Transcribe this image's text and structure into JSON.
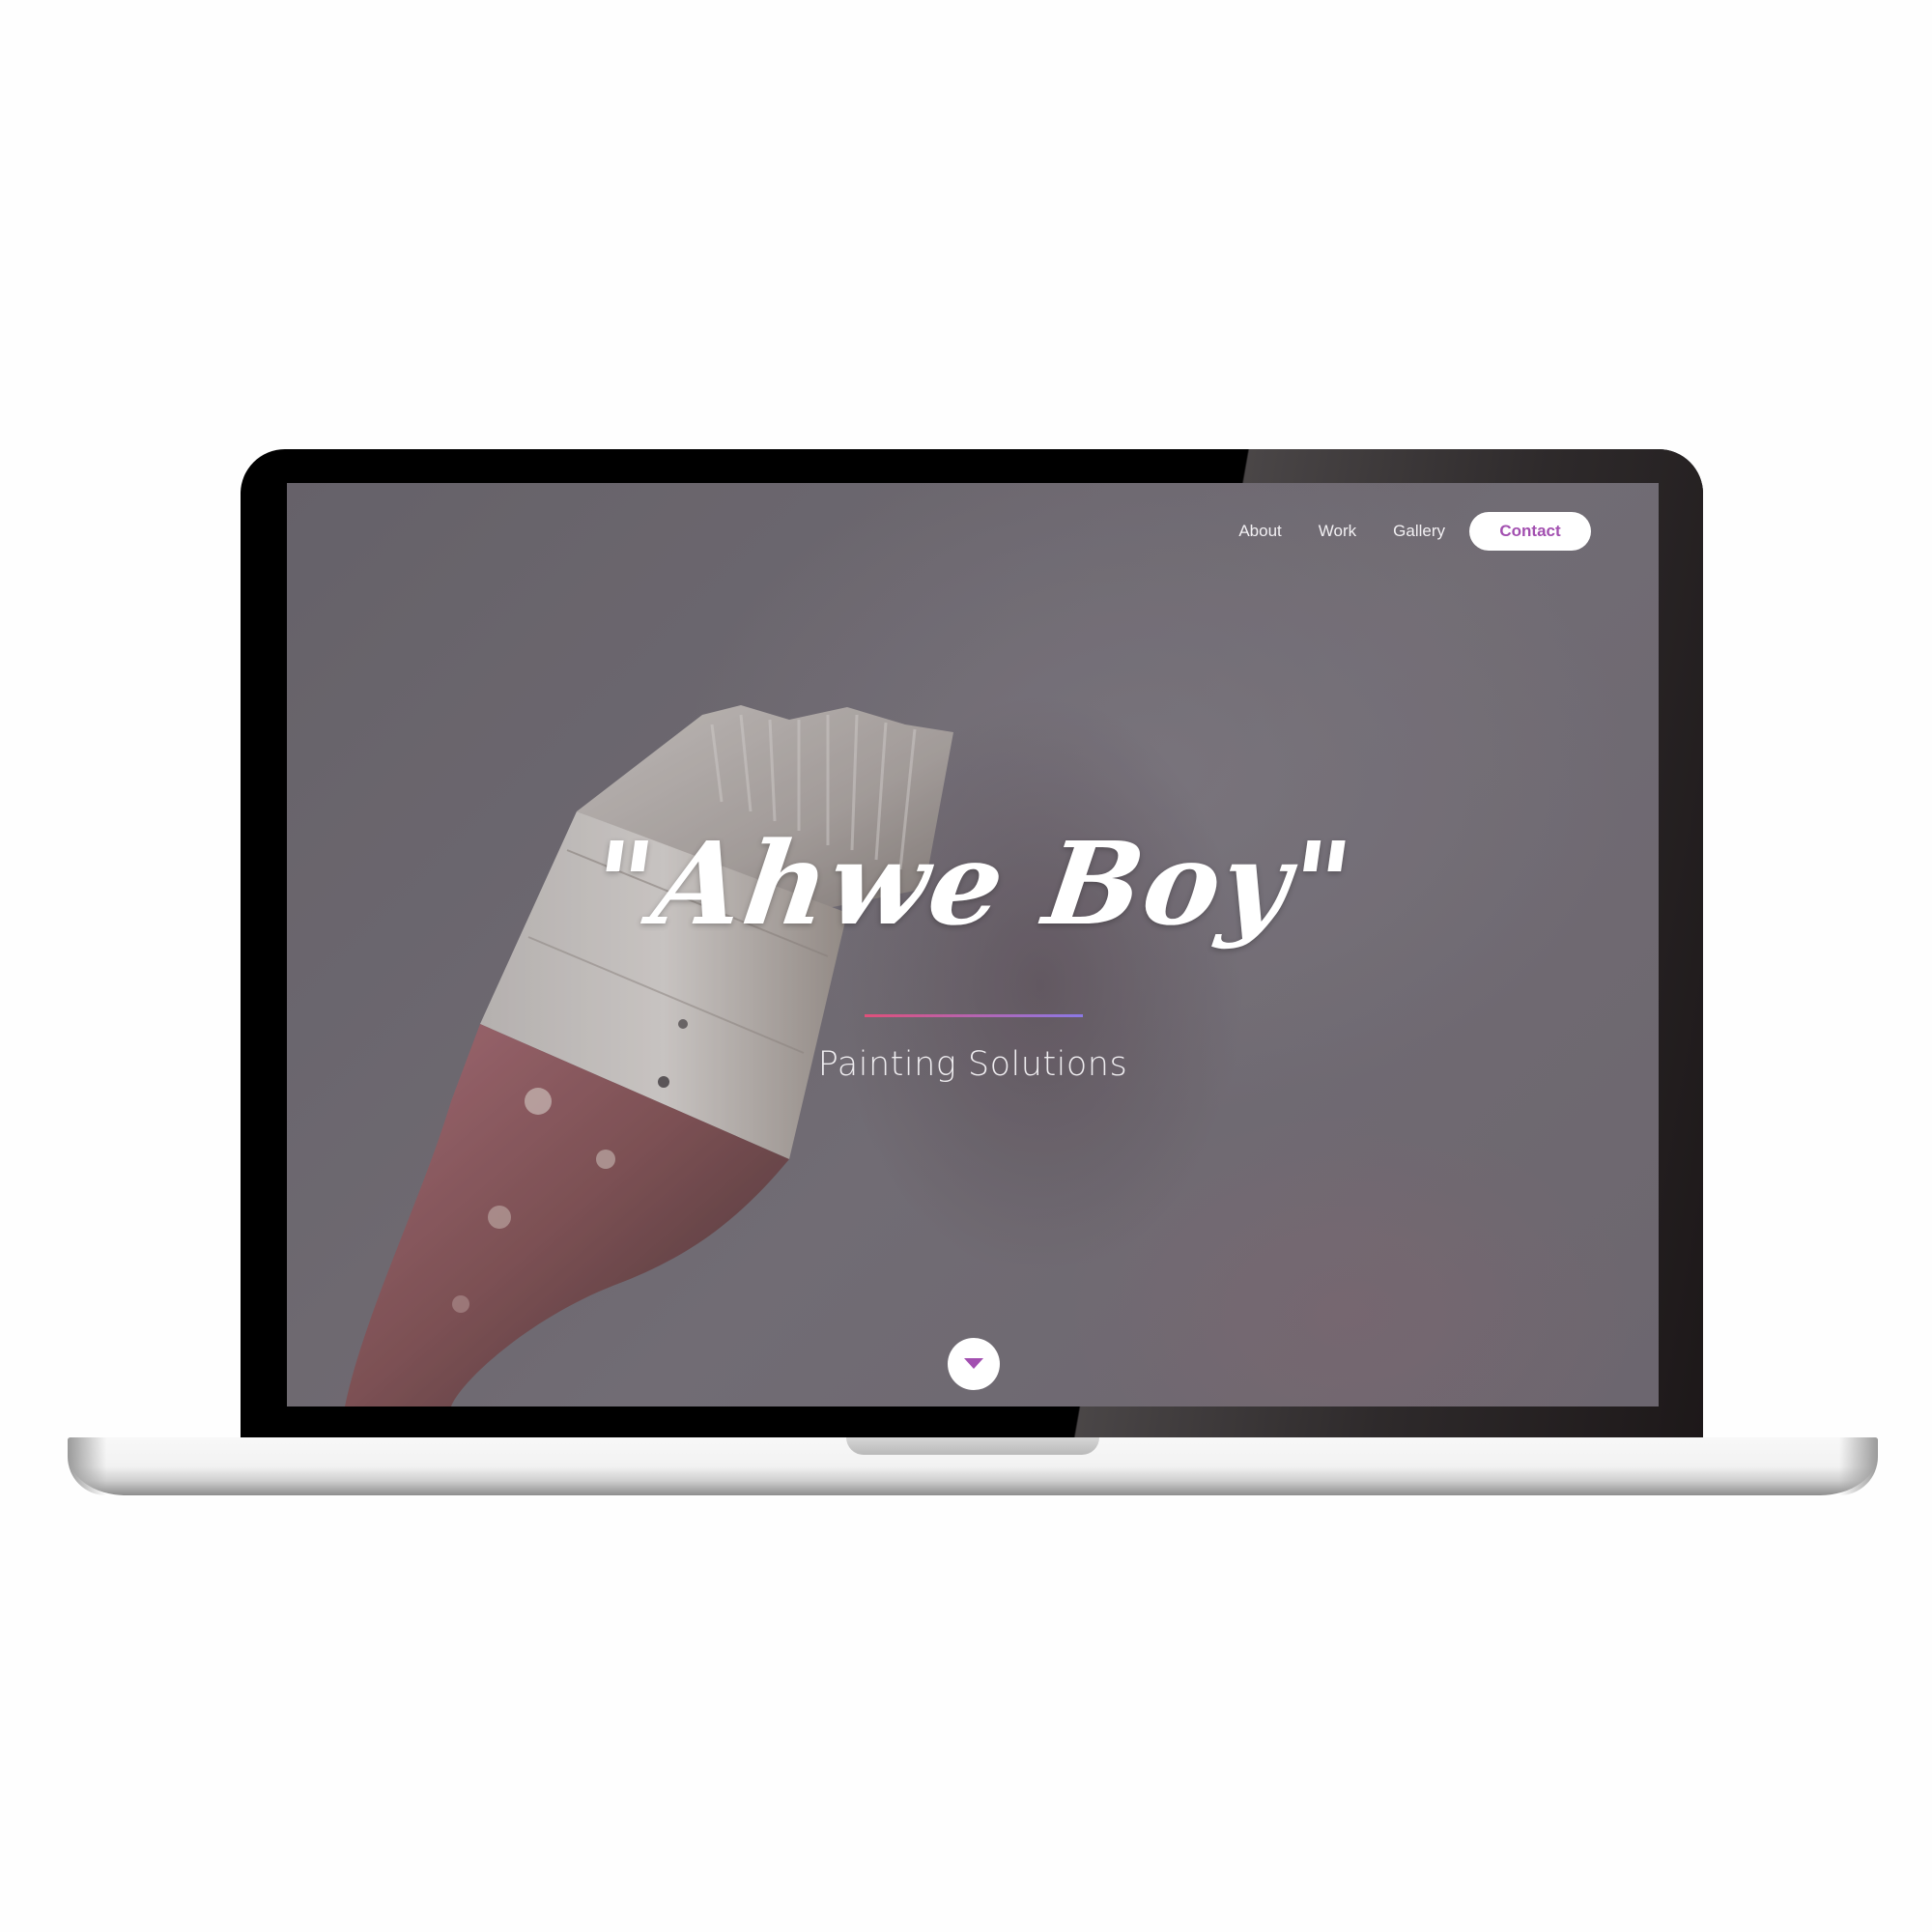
{
  "nav": {
    "items": [
      {
        "label": "About"
      },
      {
        "label": "Work"
      },
      {
        "label": "Gallery"
      }
    ],
    "contact_label": "Contact"
  },
  "hero": {
    "title": "\"Ahwe Boy\"",
    "subtitle": "Painting Solutions",
    "scroll_icon": "caret-down-icon"
  },
  "colors": {
    "accent": "#a24fb0",
    "divider_start": "#e0507a",
    "divider_end": "#8b79e6"
  }
}
